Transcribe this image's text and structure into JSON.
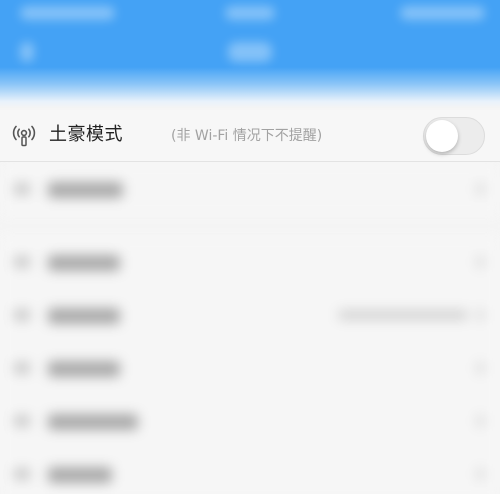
{
  "settings_row": {
    "icon": "wifi-antenna-icon",
    "title": "土豪模式",
    "hint": "(非 Wi-Fi 情况下不提醒)",
    "toggle_on": false
  },
  "colors": {
    "header_blue": "#44a2f5",
    "background": "#f5f5f5",
    "title_text": "#222222",
    "hint_text": "#a2a2a2"
  }
}
